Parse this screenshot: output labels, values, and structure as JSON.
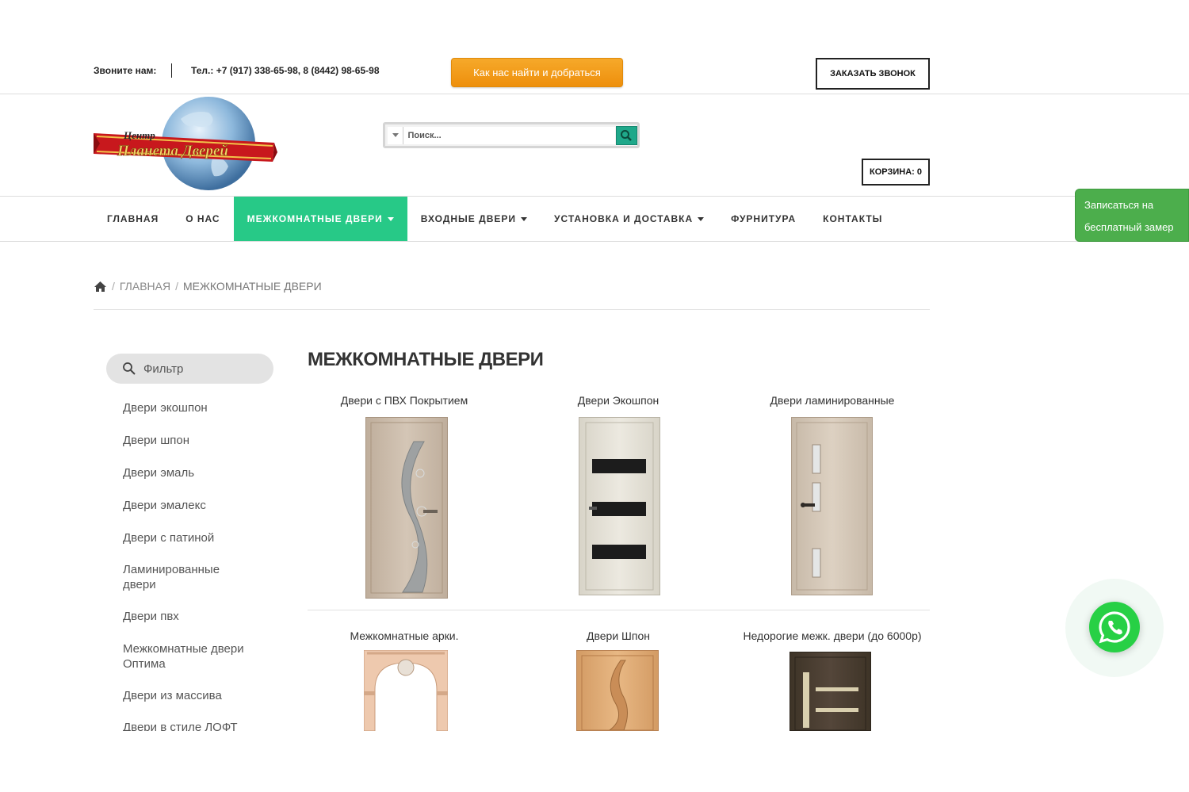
{
  "topbar": {
    "call_label": "Звоните нам:",
    "phones": "Тел.: +7 (917) 338-65-98, 8 (8442) 98-65-98",
    "find_button": "Как нас найти и добраться",
    "callback_button": "ЗАКАЗАТЬ ЗВОНОК"
  },
  "logo": {
    "line1": "Центр",
    "line2": "Планета Дверей"
  },
  "search": {
    "placeholder": "Поиск..."
  },
  "cart": {
    "label": "КОРЗИНА: 0"
  },
  "nav": {
    "items": [
      {
        "label": "ГЛАВНАЯ",
        "dropdown": false,
        "active": false
      },
      {
        "label": "О НАС",
        "dropdown": false,
        "active": false
      },
      {
        "label": "МЕЖКОМНАТНЫЕ ДВЕРИ",
        "dropdown": true,
        "active": true
      },
      {
        "label": "ВХОДНЫЕ ДВЕРИ",
        "dropdown": true,
        "active": false
      },
      {
        "label": "УСТАНОВКА И ДОСТАВКА",
        "dropdown": true,
        "active": false
      },
      {
        "label": "ФУРНИТУРА",
        "dropdown": false,
        "active": false
      },
      {
        "label": "КОНТАКТЫ",
        "dropdown": false,
        "active": false
      }
    ]
  },
  "measure_button": {
    "line1": "Записаться на",
    "line2": "бесплатный замер"
  },
  "breadcrumb": {
    "home": "ГЛАВНАЯ",
    "current": "МЕЖКОМНАТНЫЕ ДВЕРИ"
  },
  "sidebar": {
    "filter_label": "Фильтр",
    "items": [
      "Двери экошпон",
      "Двери шпон",
      "Двери эмаль",
      "Двери эмалекс",
      "Двери с патиной",
      "Ламинированные двери",
      "Двери пвх",
      "Межкомнатные двери Оптима",
      "Двери из массива",
      "Двери в стиле ЛОФТ"
    ]
  },
  "main": {
    "title": "МЕЖКОМНАТНЫЕ ДВЕРИ",
    "categories": [
      "Двери с ПВХ Покрытием",
      "Двери Экошпон",
      "Двери ламинированные",
      "Межкомнатные арки.",
      "Двери Шпон",
      "Недорогие межк. двери (до 6000р)"
    ]
  },
  "colors": {
    "nav_active": "#27c987",
    "find_button": "#f29d1c",
    "measure_button": "#4cae4c",
    "whatsapp": "#27d045"
  }
}
